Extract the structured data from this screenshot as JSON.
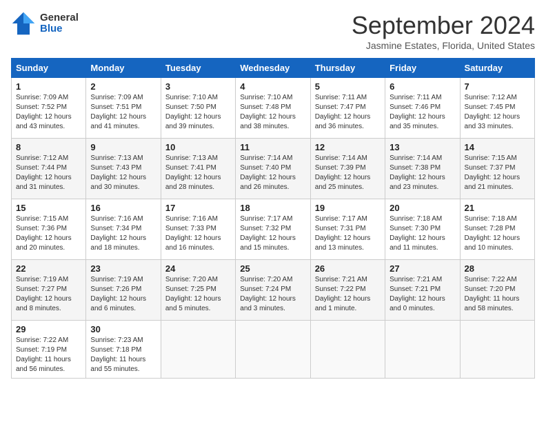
{
  "header": {
    "logo_general": "General",
    "logo_blue": "Blue",
    "title": "September 2024",
    "location": "Jasmine Estates, Florida, United States"
  },
  "days_of_week": [
    "Sunday",
    "Monday",
    "Tuesday",
    "Wednesday",
    "Thursday",
    "Friday",
    "Saturday"
  ],
  "weeks": [
    [
      {
        "day": "1",
        "info": "Sunrise: 7:09 AM\nSunset: 7:52 PM\nDaylight: 12 hours\nand 43 minutes."
      },
      {
        "day": "2",
        "info": "Sunrise: 7:09 AM\nSunset: 7:51 PM\nDaylight: 12 hours\nand 41 minutes."
      },
      {
        "day": "3",
        "info": "Sunrise: 7:10 AM\nSunset: 7:50 PM\nDaylight: 12 hours\nand 39 minutes."
      },
      {
        "day": "4",
        "info": "Sunrise: 7:10 AM\nSunset: 7:48 PM\nDaylight: 12 hours\nand 38 minutes."
      },
      {
        "day": "5",
        "info": "Sunrise: 7:11 AM\nSunset: 7:47 PM\nDaylight: 12 hours\nand 36 minutes."
      },
      {
        "day": "6",
        "info": "Sunrise: 7:11 AM\nSunset: 7:46 PM\nDaylight: 12 hours\nand 35 minutes."
      },
      {
        "day": "7",
        "info": "Sunrise: 7:12 AM\nSunset: 7:45 PM\nDaylight: 12 hours\nand 33 minutes."
      }
    ],
    [
      {
        "day": "8",
        "info": "Sunrise: 7:12 AM\nSunset: 7:44 PM\nDaylight: 12 hours\nand 31 minutes."
      },
      {
        "day": "9",
        "info": "Sunrise: 7:13 AM\nSunset: 7:43 PM\nDaylight: 12 hours\nand 30 minutes."
      },
      {
        "day": "10",
        "info": "Sunrise: 7:13 AM\nSunset: 7:41 PM\nDaylight: 12 hours\nand 28 minutes."
      },
      {
        "day": "11",
        "info": "Sunrise: 7:14 AM\nSunset: 7:40 PM\nDaylight: 12 hours\nand 26 minutes."
      },
      {
        "day": "12",
        "info": "Sunrise: 7:14 AM\nSunset: 7:39 PM\nDaylight: 12 hours\nand 25 minutes."
      },
      {
        "day": "13",
        "info": "Sunrise: 7:14 AM\nSunset: 7:38 PM\nDaylight: 12 hours\nand 23 minutes."
      },
      {
        "day": "14",
        "info": "Sunrise: 7:15 AM\nSunset: 7:37 PM\nDaylight: 12 hours\nand 21 minutes."
      }
    ],
    [
      {
        "day": "15",
        "info": "Sunrise: 7:15 AM\nSunset: 7:36 PM\nDaylight: 12 hours\nand 20 minutes."
      },
      {
        "day": "16",
        "info": "Sunrise: 7:16 AM\nSunset: 7:34 PM\nDaylight: 12 hours\nand 18 minutes."
      },
      {
        "day": "17",
        "info": "Sunrise: 7:16 AM\nSunset: 7:33 PM\nDaylight: 12 hours\nand 16 minutes."
      },
      {
        "day": "18",
        "info": "Sunrise: 7:17 AM\nSunset: 7:32 PM\nDaylight: 12 hours\nand 15 minutes."
      },
      {
        "day": "19",
        "info": "Sunrise: 7:17 AM\nSunset: 7:31 PM\nDaylight: 12 hours\nand 13 minutes."
      },
      {
        "day": "20",
        "info": "Sunrise: 7:18 AM\nSunset: 7:30 PM\nDaylight: 12 hours\nand 11 minutes."
      },
      {
        "day": "21",
        "info": "Sunrise: 7:18 AM\nSunset: 7:28 PM\nDaylight: 12 hours\nand 10 minutes."
      }
    ],
    [
      {
        "day": "22",
        "info": "Sunrise: 7:19 AM\nSunset: 7:27 PM\nDaylight: 12 hours\nand 8 minutes."
      },
      {
        "day": "23",
        "info": "Sunrise: 7:19 AM\nSunset: 7:26 PM\nDaylight: 12 hours\nand 6 minutes."
      },
      {
        "day": "24",
        "info": "Sunrise: 7:20 AM\nSunset: 7:25 PM\nDaylight: 12 hours\nand 5 minutes."
      },
      {
        "day": "25",
        "info": "Sunrise: 7:20 AM\nSunset: 7:24 PM\nDaylight: 12 hours\nand 3 minutes."
      },
      {
        "day": "26",
        "info": "Sunrise: 7:21 AM\nSunset: 7:22 PM\nDaylight: 12 hours\nand 1 minute."
      },
      {
        "day": "27",
        "info": "Sunrise: 7:21 AM\nSunset: 7:21 PM\nDaylight: 12 hours\nand 0 minutes."
      },
      {
        "day": "28",
        "info": "Sunrise: 7:22 AM\nSunset: 7:20 PM\nDaylight: 11 hours\nand 58 minutes."
      }
    ],
    [
      {
        "day": "29",
        "info": "Sunrise: 7:22 AM\nSunset: 7:19 PM\nDaylight: 11 hours\nand 56 minutes."
      },
      {
        "day": "30",
        "info": "Sunrise: 7:23 AM\nSunset: 7:18 PM\nDaylight: 11 hours\nand 55 minutes."
      },
      {
        "day": "",
        "info": ""
      },
      {
        "day": "",
        "info": ""
      },
      {
        "day": "",
        "info": ""
      },
      {
        "day": "",
        "info": ""
      },
      {
        "day": "",
        "info": ""
      }
    ]
  ]
}
